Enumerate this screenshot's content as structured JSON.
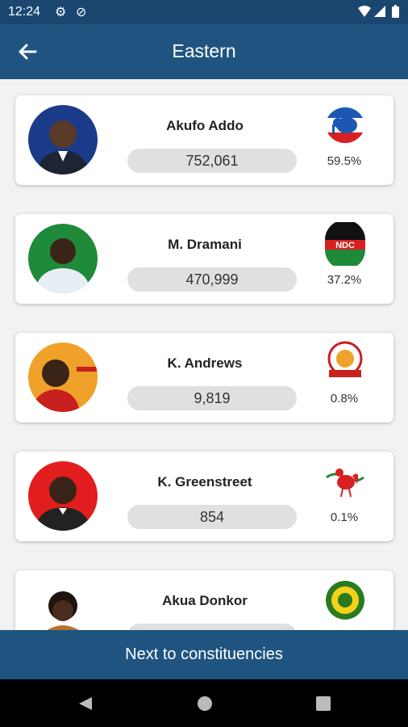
{
  "status_bar": {
    "time": "12:24",
    "icons": [
      "gear-icon",
      "do-not-disturb-icon",
      "wifi-icon",
      "signal-icon",
      "battery-icon"
    ]
  },
  "header": {
    "title": "Eastern",
    "back_icon": "arrow-left-icon"
  },
  "candidates": [
    {
      "name": "Akufo Addo",
      "votes": "752,061",
      "percent": "59.5%",
      "logo": "npp-elephant-logo",
      "avatar_bg": "#1b3a8a",
      "shirt": "#1d2433"
    },
    {
      "name": "M. Dramani",
      "votes": "470,999",
      "percent": "37.2%",
      "logo": "ndc-logo",
      "avatar_bg": "#1f8a3a",
      "shirt": "#e8eef5"
    },
    {
      "name": "K. Andrews",
      "votes": "9,819",
      "percent": "0.8%",
      "logo": "gum-logo",
      "avatar_bg": "#f0a12a",
      "shirt": "#c81f1f"
    },
    {
      "name": "K. Greenstreet",
      "votes": "854",
      "percent": "0.1%",
      "logo": "cpp-cockerel-logo",
      "avatar_bg": "#e21d1d",
      "shirt": "#222222"
    },
    {
      "name": "Akua Donkor",
      "votes": "",
      "percent": "",
      "logo": "gfp-logo",
      "avatar_bg": "#ffffff",
      "shirt": "#b8742d"
    }
  ],
  "footer": {
    "next_label": "Next to constituencies"
  },
  "nav": {
    "icons": [
      "back-triangle-icon",
      "home-circle-icon",
      "recents-square-icon"
    ]
  },
  "colors": {
    "app_bar": "#1f5480",
    "status_bar": "#1a4670",
    "background": "#f2f2f2"
  }
}
